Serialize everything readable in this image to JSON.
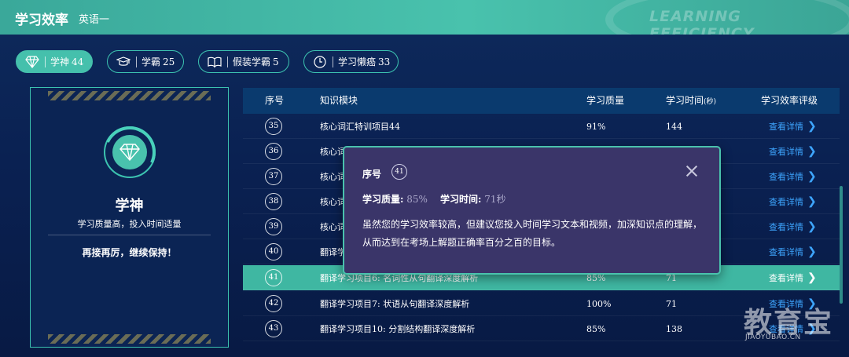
{
  "header": {
    "title": "学习效率",
    "subject": "英语一",
    "watermark": "LEARNING EFFICIENCY"
  },
  "tabs": [
    {
      "label": "学神",
      "count": "44",
      "icon": "diamond-icon",
      "active": true
    },
    {
      "label": "学霸",
      "count": "25",
      "icon": "graduation-cap-icon",
      "active": false
    },
    {
      "label": "假装学霸",
      "count": "5",
      "icon": "open-book-icon",
      "active": false
    },
    {
      "label": "学习懒癌",
      "count": "33",
      "icon": "clock-icon",
      "active": false
    }
  ],
  "card": {
    "level_name": "学神",
    "level_desc": "学习质量高，投入时间适量",
    "encourage": "再接再厉，继续保持！",
    "icon": "diamond-icon"
  },
  "table": {
    "headers": {
      "index": "序号",
      "module": "知识模块",
      "quality": "学习质量",
      "time": "学习时间",
      "time_unit": "(秒)",
      "rating": "学习效率评级"
    },
    "rows": [
      {
        "num": "35",
        "module": "核心词汇特训项目44",
        "quality": "91%",
        "time": "144",
        "action": "查看详情"
      },
      {
        "num": "36",
        "module": "核心词",
        "quality": "",
        "time": "",
        "action": "查看详情"
      },
      {
        "num": "37",
        "module": "核心词",
        "quality": "",
        "time": "",
        "action": "查看详情"
      },
      {
        "num": "38",
        "module": "核心词",
        "quality": "",
        "time": "",
        "action": "查看详情"
      },
      {
        "num": "39",
        "module": "核心词",
        "quality": "",
        "time": "",
        "action": "查看详情"
      },
      {
        "num": "40",
        "module": "翻译学",
        "quality": "",
        "time": "",
        "action": "查看详情"
      },
      {
        "num": "41",
        "module": "翻译学习项目6: 名词性从句翻译深度解析",
        "quality": "85%",
        "time": "71",
        "action": "查看详情"
      },
      {
        "num": "42",
        "module": "翻译学习项目7: 状语从句翻译深度解析",
        "quality": "100%",
        "time": "71",
        "action": "查看详情"
      },
      {
        "num": "43",
        "module": "翻译学习项目10: 分割结构翻译深度解析",
        "quality": "85%",
        "time": "138",
        "action": "查看详情"
      }
    ],
    "highlight_index": 6
  },
  "popup": {
    "index_label": "序号",
    "index_value": "41",
    "quality_label": "学习质量:",
    "quality_value": "85%",
    "time_label": "学习时间:",
    "time_value": "71秒",
    "message": "虽然您的学习效率较高，但建议您投入时间学习文本和视频，加深知识点的理解，从而达到在考场上解题正确率百分之百的目标。"
  },
  "brand": {
    "name": "教育宝",
    "domain": "JIAOYUBAO.CN"
  },
  "colors": {
    "accent": "#45c0ac",
    "background": "#0a2152",
    "link": "#3ea6ff",
    "popup_bg": "#3a3569"
  }
}
